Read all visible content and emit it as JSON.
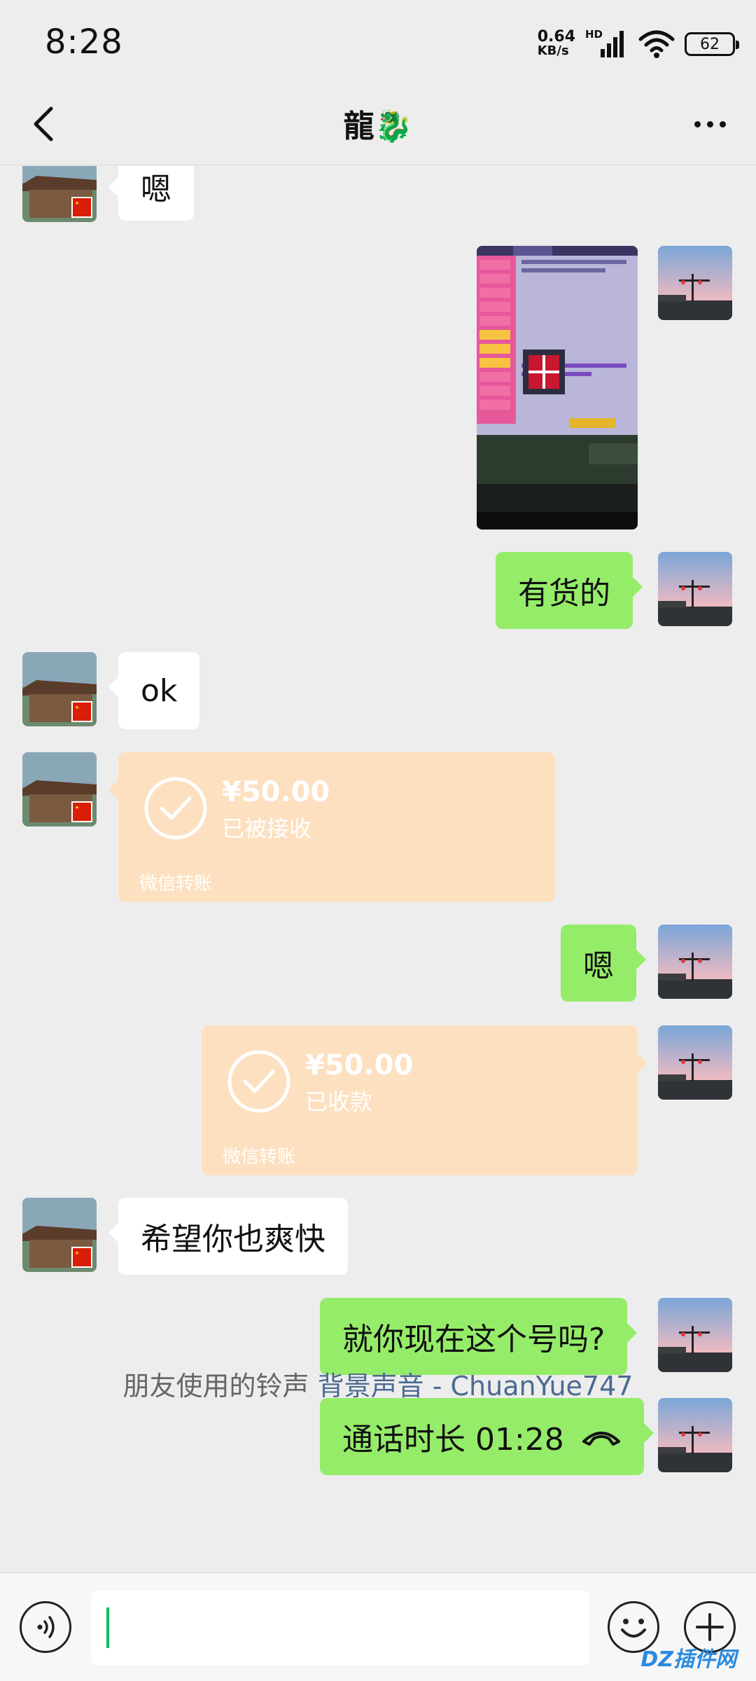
{
  "status_bar": {
    "time": "8:28",
    "net_speed_value": "0.64",
    "net_speed_unit": "KB/s",
    "network_type": "HD",
    "battery_level": "62"
  },
  "header": {
    "title": "龍🐉",
    "back_icon": "chevron-left-icon",
    "more_icon": "more-dots-icon"
  },
  "messages": [
    {
      "side": "left",
      "type": "text",
      "text": "嗯"
    },
    {
      "side": "right",
      "type": "image",
      "description": "screenshot photo"
    },
    {
      "side": "right",
      "type": "text",
      "text": "有货的"
    },
    {
      "side": "left",
      "type": "text",
      "text": "ok"
    },
    {
      "side": "left",
      "type": "transfer",
      "amount": "¥50.00",
      "status": "已被接收",
      "footer": "微信转账"
    },
    {
      "side": "right",
      "type": "text",
      "text": "嗯"
    },
    {
      "side": "right",
      "type": "transfer",
      "amount": "¥50.00",
      "status": "已收款",
      "footer": "微信转账"
    },
    {
      "side": "left",
      "type": "text",
      "text": "希望你也爽快"
    },
    {
      "side": "right",
      "type": "text",
      "text": "就你现在这个号吗?"
    },
    {
      "side": "right",
      "type": "call",
      "text": "通话时长 01:28"
    }
  ],
  "ringtone": {
    "prefix": "朋友使用的铃声",
    "link": "背景声音 - ChuanYue747"
  },
  "input_bar": {
    "value": "",
    "voice_icon": "voice-icon",
    "emoji_icon": "emoji-icon",
    "plus_icon": "plus-icon"
  },
  "watermark": "DZ插件网",
  "colors": {
    "background": "#ededed",
    "sent_bubble": "#95ec69",
    "received_bubble": "#ffffff",
    "transfer_bubble": "#fde0c0",
    "link": "#4a6a92",
    "caret": "#07c160"
  }
}
